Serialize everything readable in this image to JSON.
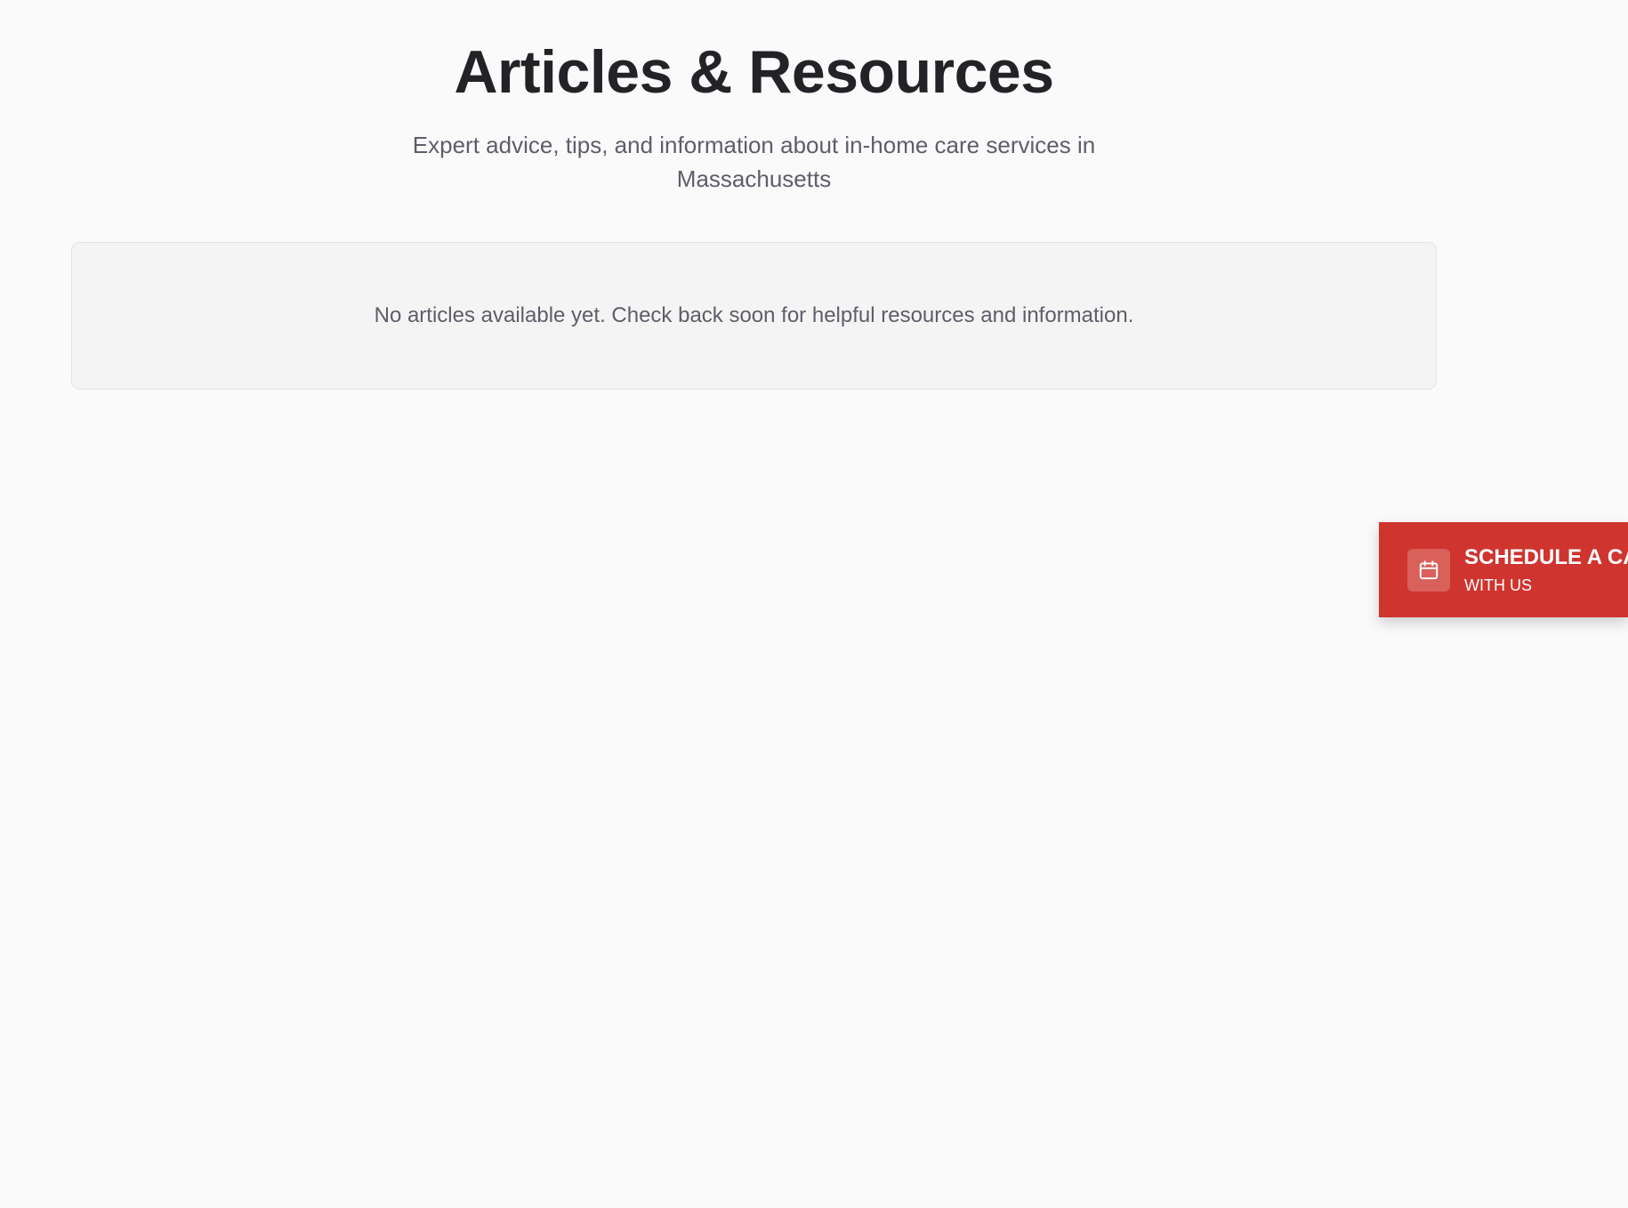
{
  "header": {
    "title": "Articles & Resources",
    "subtitle": "Expert advice, tips, and information about in-home care services in Massachusetts"
  },
  "empty_state": {
    "message": "No articles available yet. Check back soon for helpful resources and information."
  },
  "schedule_tab": {
    "title": "SCHEDULE A CA",
    "subtitle": "WITH US",
    "icon": "calendar-icon",
    "color": "#cf342e"
  },
  "colors": {
    "background": "#fafafa",
    "heading": "#232327",
    "muted_text": "#5e5e6a",
    "card_background": "#f4f4f4",
    "accent": "#cf342e"
  }
}
